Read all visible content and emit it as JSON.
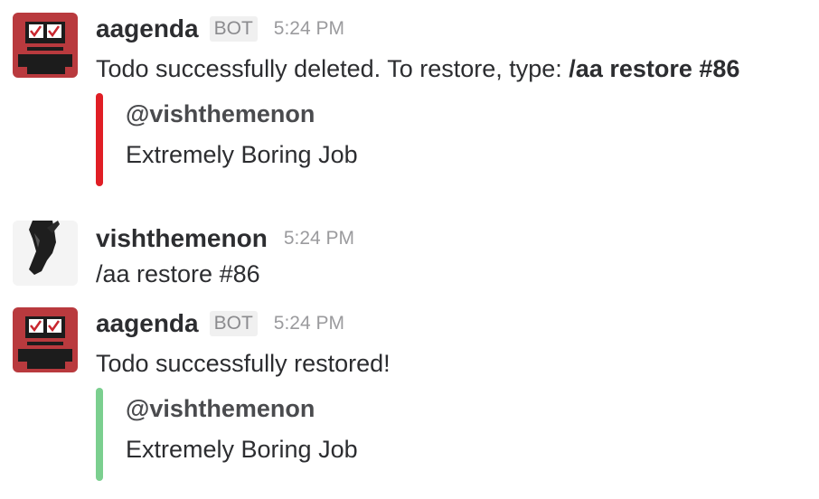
{
  "messages": [
    {
      "username": "aagenda",
      "badge": "BOT",
      "time": "5:24 PM",
      "text_prefix": "Todo successfully deleted. To restore, type: ",
      "text_command": "/aa restore #86",
      "attachment": {
        "title": "@vishthemenon",
        "text": "Extremely Boring Job",
        "color": "#e01e25"
      }
    },
    {
      "username": "vishthemenon",
      "time": "5:24 PM",
      "text": "/aa restore #86"
    },
    {
      "username": "aagenda",
      "badge": "BOT",
      "time": "5:24 PM",
      "text": "Todo successfully restored!",
      "attachment": {
        "title": "@vishthemenon",
        "text": "Extremely Boring Job",
        "color": "#7bcf8f"
      }
    }
  ],
  "colors": {
    "bot_avatar_bg": "#b93a3e",
    "deleted_accent": "#e01e25",
    "restored_accent": "#7bcf8f"
  }
}
